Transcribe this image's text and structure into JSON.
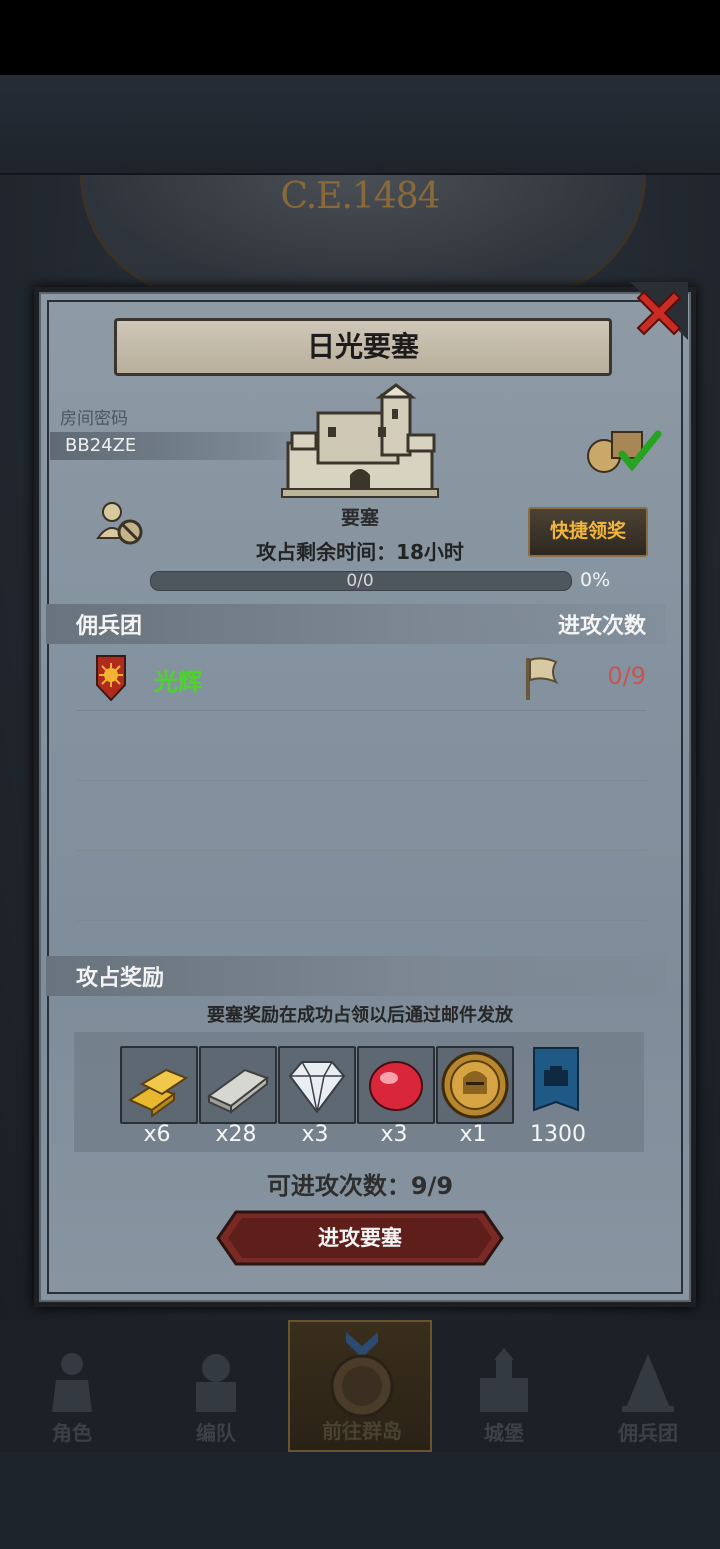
{
  "background": {
    "year_text": "C.E.1484"
  },
  "dialog": {
    "title": "日光要塞",
    "room_label": "房间密码",
    "room_code": "BB24ZE",
    "fortress_label": "要塞",
    "remaining_time": "攻占剩余时间：18小时",
    "quick_claim_label": "快捷领奖",
    "progress": {
      "text": "0/0",
      "percent_text": "0%",
      "fraction": 0
    },
    "mercenary_header": "佣兵团",
    "attack_count_header": "进攻次数",
    "guilds": [
      {
        "name": "光辉",
        "attacks": "0/9"
      }
    ],
    "rewards_header": "攻占奖励",
    "rewards_note": "要塞奖励在成功占领以后通过邮件发放",
    "rewards": [
      {
        "icon": "gold-bars-icon",
        "count": "x6"
      },
      {
        "icon": "silver-bar-icon",
        "count": "x28"
      },
      {
        "icon": "diamond-icon",
        "count": "x3"
      },
      {
        "icon": "ruby-icon",
        "count": "x3"
      },
      {
        "icon": "knight-helmet-coin-icon",
        "count": "x1"
      },
      {
        "icon": "fortress-banner-icon",
        "count": "1300"
      }
    ],
    "remaining_attacks": "可进攻次数：9/9",
    "attack_button_label": "进攻要塞"
  },
  "bottom_nav": [
    {
      "label": "角色",
      "icon": "character-icon"
    },
    {
      "label": "编队",
      "icon": "formation-icon"
    },
    {
      "label": "前往群岛",
      "icon": "archipelago-icon",
      "active": true
    },
    {
      "label": "城堡",
      "icon": "castle-icon"
    },
    {
      "label": "佣兵团",
      "icon": "mercenary-icon"
    }
  ],
  "colors": {
    "guild_name": "#4fd12f",
    "attacks_used": "#c65454",
    "quick_button_text": "#f1b53c"
  }
}
